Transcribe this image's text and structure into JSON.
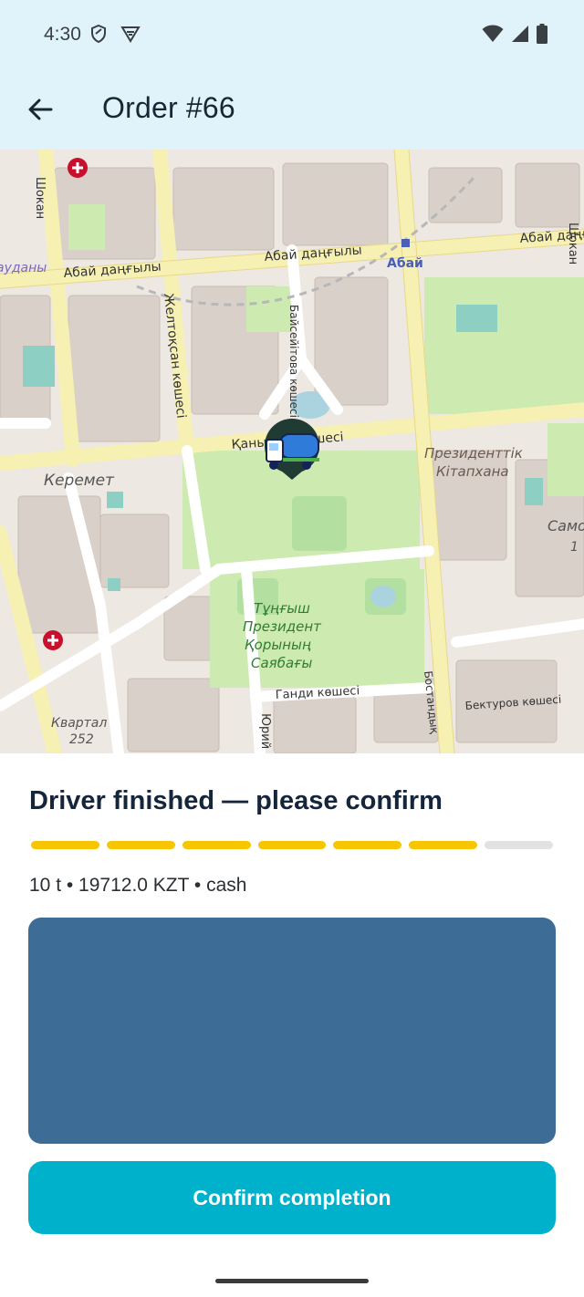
{
  "status_bar": {
    "time": "4:30",
    "icons": [
      "shield-icon",
      "vpn-icon",
      "wifi-icon",
      "signal-icon",
      "battery-icon"
    ]
  },
  "app_bar": {
    "back_icon": "arrow-left-icon",
    "title": "Order #66"
  },
  "map": {
    "labels": {
      "abai_1": "Абай даңғылы",
      "abai_2": "Абай даңғылы",
      "abai_3": "Абай даңғылы",
      "abai_metro": "Абай",
      "zheltoksan": "Желтоқсан көшесі",
      "baiseitova": "Байсейітова көшесі",
      "kabanbay": "Қаны     аев көшесі",
      "keremet": "Керемет",
      "library_1": "Президенттік",
      "library_2": "Кітапхана",
      "park_1": "Тұңғыш",
      "park_2": "Президент",
      "park_3": "Қорының",
      "park_4": "Саябағы",
      "gandi": "Ганди көшесі",
      "bekturov": "Бектуров көшесі",
      "bostandyk": "Бостандық",
      "kvartal": "Квартал",
      "kvartal_num": "252",
      "yurii": "Юрий Г",
      "edge_ayda": "ауданы",
      "edge_sam": "Само",
      "edge_one": "1",
      "edge_shok": "Шокан"
    },
    "marker_icon": "truck-marker-icon",
    "hospital_icon": "hospital-icon"
  },
  "order": {
    "status_title": "Driver finished — please confirm",
    "progress_total": 7,
    "progress_done": 6,
    "summary": "10 t • 19712.0 KZT • cash",
    "confirm_label": "Confirm completion"
  },
  "colors": {
    "app_bar_bg": "#e0f3fa",
    "progress_done": "#f7c600",
    "progress_todo": "#e2e2e2",
    "media_panel": "#3d6d96",
    "confirm_button": "#00b1cc"
  }
}
